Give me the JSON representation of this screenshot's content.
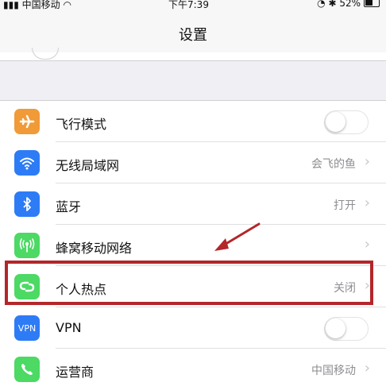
{
  "status_bar": {
    "carrier": "中国移动",
    "time": "下午7:39",
    "battery": "52%"
  },
  "header": {
    "title": "设置"
  },
  "settings": [
    {
      "label": "飞行模式",
      "value": "",
      "icon": "airplane-icon",
      "icon_color": "#f19a38",
      "control": "toggle",
      "toggle_on": false
    },
    {
      "label": "无线局域网",
      "value": "会飞的鱼",
      "icon": "wifi-icon",
      "icon_color": "#2d7cf6",
      "control": "chevron"
    },
    {
      "label": "蓝牙",
      "value": "打开",
      "icon": "bluetooth-icon",
      "icon_color": "#2d7cf6",
      "control": "chevron"
    },
    {
      "label": "蜂窝移动网络",
      "value": "",
      "icon": "cellular-icon",
      "icon_color": "#4cd964",
      "control": "chevron"
    },
    {
      "label": "个人热点",
      "value": "关闭",
      "icon": "hotspot-icon",
      "icon_color": "#4cd964",
      "control": "chevron"
    },
    {
      "label": "VPN",
      "value": "",
      "icon": "vpn-icon",
      "icon_color": "#2d7cf6",
      "icon_text": "VPN",
      "control": "toggle",
      "toggle_on": false
    },
    {
      "label": "运营商",
      "value": "中国移动",
      "icon": "phone-icon",
      "icon_color": "#4cd964",
      "control": "chevron"
    }
  ],
  "annotation": {
    "highlight_color": "#b3262a",
    "highlighted_item": "个人热点"
  }
}
